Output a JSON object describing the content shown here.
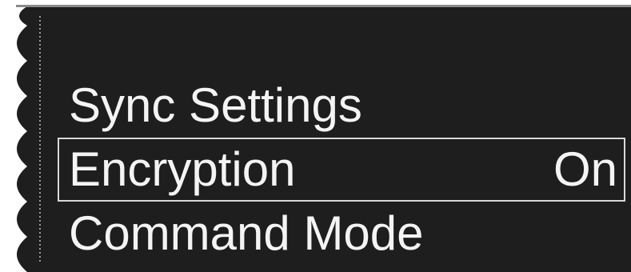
{
  "menu": {
    "items": [
      {
        "label": "Sync Settings",
        "value": "",
        "selected": false
      },
      {
        "label": "Encryption",
        "value": "On",
        "selected": true
      },
      {
        "label": "Command Mode",
        "value": "",
        "selected": false
      }
    ]
  },
  "colors": {
    "panel_background": "#1e1e1e",
    "text": "#f4f4f4",
    "selection_border": "#d8d8d8"
  }
}
